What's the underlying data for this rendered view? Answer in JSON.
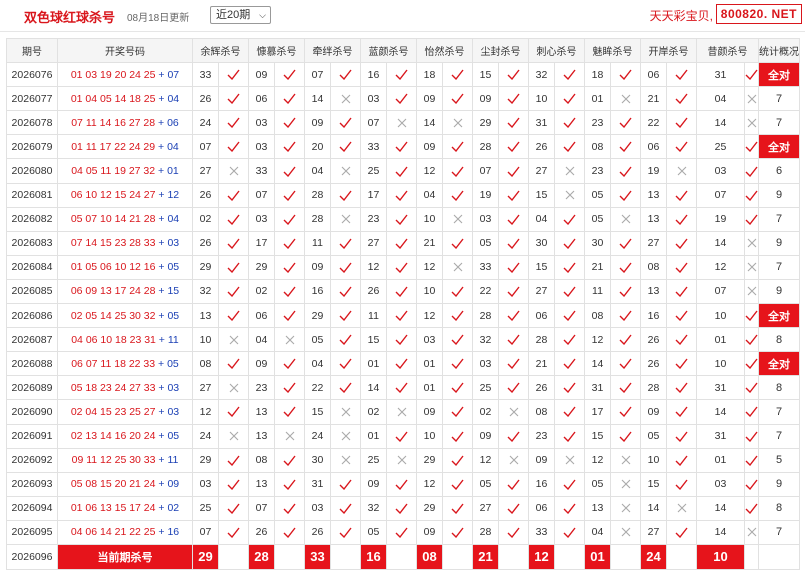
{
  "header": {
    "title": "双色球红球杀号",
    "update_text": "08月18日更新",
    "range_select": "近20期",
    "brand": "天天彩宝贝,",
    "site": "800820. NET"
  },
  "columns": [
    "期号",
    "开奖号码",
    "余辉杀号",
    "慷慕杀号",
    "牵绊杀号",
    "蓝颜杀号",
    "怡然杀号",
    "尘封杀号",
    "刺心杀号",
    "魅眸杀号",
    "开岸杀号",
    "昔颜杀号",
    "统计概况"
  ],
  "rows": [
    {
      "period": "2026076",
      "red": "01 03 19 20 24 25",
      "blue": "07",
      "kills": [
        [
          "33",
          1
        ],
        [
          "09",
          1
        ],
        [
          "07",
          1
        ],
        [
          "16",
          1
        ],
        [
          "18",
          1
        ],
        [
          "15",
          1
        ],
        [
          "32",
          1
        ],
        [
          "18",
          1
        ],
        [
          "06",
          1
        ],
        [
          "31",
          1
        ]
      ],
      "stat": "全对"
    },
    {
      "period": "2026077",
      "red": "01 04 05 14 18 25",
      "blue": "04",
      "kills": [
        [
          "26",
          1
        ],
        [
          "06",
          1
        ],
        [
          "14",
          0
        ],
        [
          "03",
          1
        ],
        [
          "09",
          1
        ],
        [
          "09",
          1
        ],
        [
          "10",
          1
        ],
        [
          "01",
          0
        ],
        [
          "21",
          1
        ],
        [
          "04",
          0
        ]
      ],
      "stat": "7"
    },
    {
      "period": "2026078",
      "red": "07 11 14 16 27 28",
      "blue": "06",
      "kills": [
        [
          "24",
          1
        ],
        [
          "03",
          1
        ],
        [
          "09",
          1
        ],
        [
          "07",
          0
        ],
        [
          "14",
          0
        ],
        [
          "29",
          1
        ],
        [
          "31",
          1
        ],
        [
          "23",
          1
        ],
        [
          "22",
          1
        ],
        [
          "14",
          0
        ]
      ],
      "stat": "7"
    },
    {
      "period": "2026079",
      "red": "01 11 17 22 24 29",
      "blue": "04",
      "kills": [
        [
          "07",
          1
        ],
        [
          "03",
          1
        ],
        [
          "20",
          1
        ],
        [
          "33",
          1
        ],
        [
          "09",
          1
        ],
        [
          "28",
          1
        ],
        [
          "26",
          1
        ],
        [
          "08",
          1
        ],
        [
          "06",
          1
        ],
        [
          "25",
          1
        ]
      ],
      "stat": "全对"
    },
    {
      "period": "2026080",
      "red": "04 05 11 19 27 32",
      "blue": "01",
      "kills": [
        [
          "27",
          0
        ],
        [
          "33",
          1
        ],
        [
          "04",
          0
        ],
        [
          "25",
          1
        ],
        [
          "12",
          1
        ],
        [
          "07",
          1
        ],
        [
          "27",
          0
        ],
        [
          "23",
          1
        ],
        [
          "19",
          0
        ],
        [
          "03",
          1
        ]
      ],
      "stat": "6"
    },
    {
      "period": "2026081",
      "red": "06 10 12 15 24 27",
      "blue": "12",
      "kills": [
        [
          "26",
          1
        ],
        [
          "07",
          1
        ],
        [
          "28",
          1
        ],
        [
          "17",
          1
        ],
        [
          "04",
          1
        ],
        [
          "19",
          1
        ],
        [
          "15",
          0
        ],
        [
          "05",
          1
        ],
        [
          "13",
          1
        ],
        [
          "07",
          1
        ]
      ],
      "stat": "9"
    },
    {
      "period": "2026082",
      "red": "05 07 10 14 21 28",
      "blue": "04",
      "kills": [
        [
          "02",
          1
        ],
        [
          "03",
          1
        ],
        [
          "28",
          0
        ],
        [
          "23",
          1
        ],
        [
          "10",
          0
        ],
        [
          "03",
          1
        ],
        [
          "04",
          1
        ],
        [
          "05",
          0
        ],
        [
          "13",
          1
        ],
        [
          "19",
          1
        ]
      ],
      "stat": "7"
    },
    {
      "period": "2026083",
      "red": "07 14 15 23 28 33",
      "blue": "03",
      "kills": [
        [
          "26",
          1
        ],
        [
          "17",
          1
        ],
        [
          "11",
          1
        ],
        [
          "27",
          1
        ],
        [
          "21",
          1
        ],
        [
          "05",
          1
        ],
        [
          "30",
          1
        ],
        [
          "30",
          1
        ],
        [
          "27",
          1
        ],
        [
          "14",
          0
        ]
      ],
      "stat": "9"
    },
    {
      "period": "2026084",
      "red": "01 05 06 10 12 16",
      "blue": "05",
      "kills": [
        [
          "29",
          1
        ],
        [
          "29",
          1
        ],
        [
          "09",
          1
        ],
        [
          "12",
          1
        ],
        [
          "12",
          0
        ],
        [
          "33",
          1
        ],
        [
          "15",
          1
        ],
        [
          "21",
          1
        ],
        [
          "08",
          1
        ],
        [
          "12",
          0
        ]
      ],
      "stat": "7"
    },
    {
      "period": "2026085",
      "red": "06 09 13 17 24 28",
      "blue": "15",
      "kills": [
        [
          "32",
          1
        ],
        [
          "02",
          1
        ],
        [
          "16",
          1
        ],
        [
          "26",
          1
        ],
        [
          "10",
          1
        ],
        [
          "22",
          1
        ],
        [
          "27",
          1
        ],
        [
          "11",
          1
        ],
        [
          "13",
          1
        ],
        [
          "07",
          0
        ]
      ],
      "stat": "9"
    },
    {
      "period": "2026086",
      "red": "02 05 14 25 30 32",
      "blue": "05",
      "kills": [
        [
          "13",
          1
        ],
        [
          "06",
          1
        ],
        [
          "29",
          1
        ],
        [
          "11",
          1
        ],
        [
          "12",
          1
        ],
        [
          "28",
          1
        ],
        [
          "06",
          1
        ],
        [
          "08",
          1
        ],
        [
          "16",
          1
        ],
        [
          "10",
          1
        ]
      ],
      "stat": "全对"
    },
    {
      "period": "2026087",
      "red": "04 06 10 18 23 31",
      "blue": "11",
      "kills": [
        [
          "10",
          0
        ],
        [
          "04",
          0
        ],
        [
          "05",
          1
        ],
        [
          "15",
          1
        ],
        [
          "03",
          1
        ],
        [
          "32",
          1
        ],
        [
          "28",
          1
        ],
        [
          "12",
          1
        ],
        [
          "26",
          1
        ],
        [
          "01",
          1
        ]
      ],
      "stat": "8"
    },
    {
      "period": "2026088",
      "red": "06 07 11 18 22 33",
      "blue": "05",
      "kills": [
        [
          "08",
          1
        ],
        [
          "09",
          1
        ],
        [
          "04",
          1
        ],
        [
          "01",
          1
        ],
        [
          "01",
          1
        ],
        [
          "03",
          1
        ],
        [
          "21",
          1
        ],
        [
          "14",
          1
        ],
        [
          "26",
          1
        ],
        [
          "10",
          1
        ]
      ],
      "stat": "全对"
    },
    {
      "period": "2026089",
      "red": "05 18 23 24 27 33",
      "blue": "03",
      "kills": [
        [
          "27",
          0
        ],
        [
          "23",
          1
        ],
        [
          "22",
          1
        ],
        [
          "14",
          1
        ],
        [
          "01",
          1
        ],
        [
          "25",
          1
        ],
        [
          "26",
          1
        ],
        [
          "31",
          1
        ],
        [
          "28",
          1
        ],
        [
          "31",
          1
        ]
      ],
      "stat": "8"
    },
    {
      "period": "2026090",
      "red": "02 04 15 23 25 27",
      "blue": "03",
      "kills": [
        [
          "12",
          1
        ],
        [
          "13",
          1
        ],
        [
          "15",
          0
        ],
        [
          "02",
          0
        ],
        [
          "09",
          1
        ],
        [
          "02",
          0
        ],
        [
          "08",
          1
        ],
        [
          "17",
          1
        ],
        [
          "09",
          1
        ],
        [
          "14",
          1
        ]
      ],
      "stat": "7"
    },
    {
      "period": "2026091",
      "red": "02 13 14 16 20 24",
      "blue": "05",
      "kills": [
        [
          "24",
          0
        ],
        [
          "13",
          0
        ],
        [
          "24",
          0
        ],
        [
          "01",
          1
        ],
        [
          "10",
          1
        ],
        [
          "09",
          1
        ],
        [
          "23",
          1
        ],
        [
          "15",
          1
        ],
        [
          "05",
          1
        ],
        [
          "31",
          1
        ]
      ],
      "stat": "7"
    },
    {
      "period": "2026092",
      "red": "09 11 12 25 30 33",
      "blue": "11",
      "kills": [
        [
          "29",
          1
        ],
        [
          "08",
          1
        ],
        [
          "30",
          0
        ],
        [
          "25",
          0
        ],
        [
          "29",
          1
        ],
        [
          "12",
          0
        ],
        [
          "09",
          0
        ],
        [
          "12",
          0
        ],
        [
          "10",
          1
        ],
        [
          "01",
          1
        ]
      ],
      "stat": "5"
    },
    {
      "period": "2026093",
      "red": "05 08 15 20 21 24",
      "blue": "09",
      "kills": [
        [
          "03",
          1
        ],
        [
          "13",
          1
        ],
        [
          "31",
          1
        ],
        [
          "09",
          1
        ],
        [
          "12",
          1
        ],
        [
          "05",
          1
        ],
        [
          "16",
          1
        ],
        [
          "05",
          0
        ],
        [
          "15",
          1
        ],
        [
          "03",
          1
        ]
      ],
      "stat": "9"
    },
    {
      "period": "2026094",
      "red": "01 06 13 15 17 24",
      "blue": "02",
      "kills": [
        [
          "25",
          1
        ],
        [
          "07",
          1
        ],
        [
          "03",
          1
        ],
        [
          "32",
          1
        ],
        [
          "29",
          1
        ],
        [
          "27",
          1
        ],
        [
          "06",
          1
        ],
        [
          "13",
          0
        ],
        [
          "14",
          0
        ],
        [
          "14",
          1
        ]
      ],
      "stat": "8"
    },
    {
      "period": "2026095",
      "red": "04 06 14 21 22 25",
      "blue": "16",
      "kills": [
        [
          "07",
          1
        ],
        [
          "26",
          1
        ],
        [
          "26",
          1
        ],
        [
          "05",
          1
        ],
        [
          "09",
          1
        ],
        [
          "28",
          1
        ],
        [
          "33",
          1
        ],
        [
          "04",
          0
        ],
        [
          "27",
          1
        ],
        [
          "14",
          0
        ]
      ],
      "stat": "7"
    }
  ],
  "current": {
    "period": "2026096",
    "label": "当前期杀号",
    "kills": [
      "29",
      "28",
      "33",
      "16",
      "08",
      "21",
      "12",
      "01",
      "24",
      "10"
    ]
  },
  "colors": {
    "accent": "#e6141b",
    "check": "#d9161c",
    "cross": "#aaaaaa",
    "blue_ball": "#1a3fb4"
  }
}
